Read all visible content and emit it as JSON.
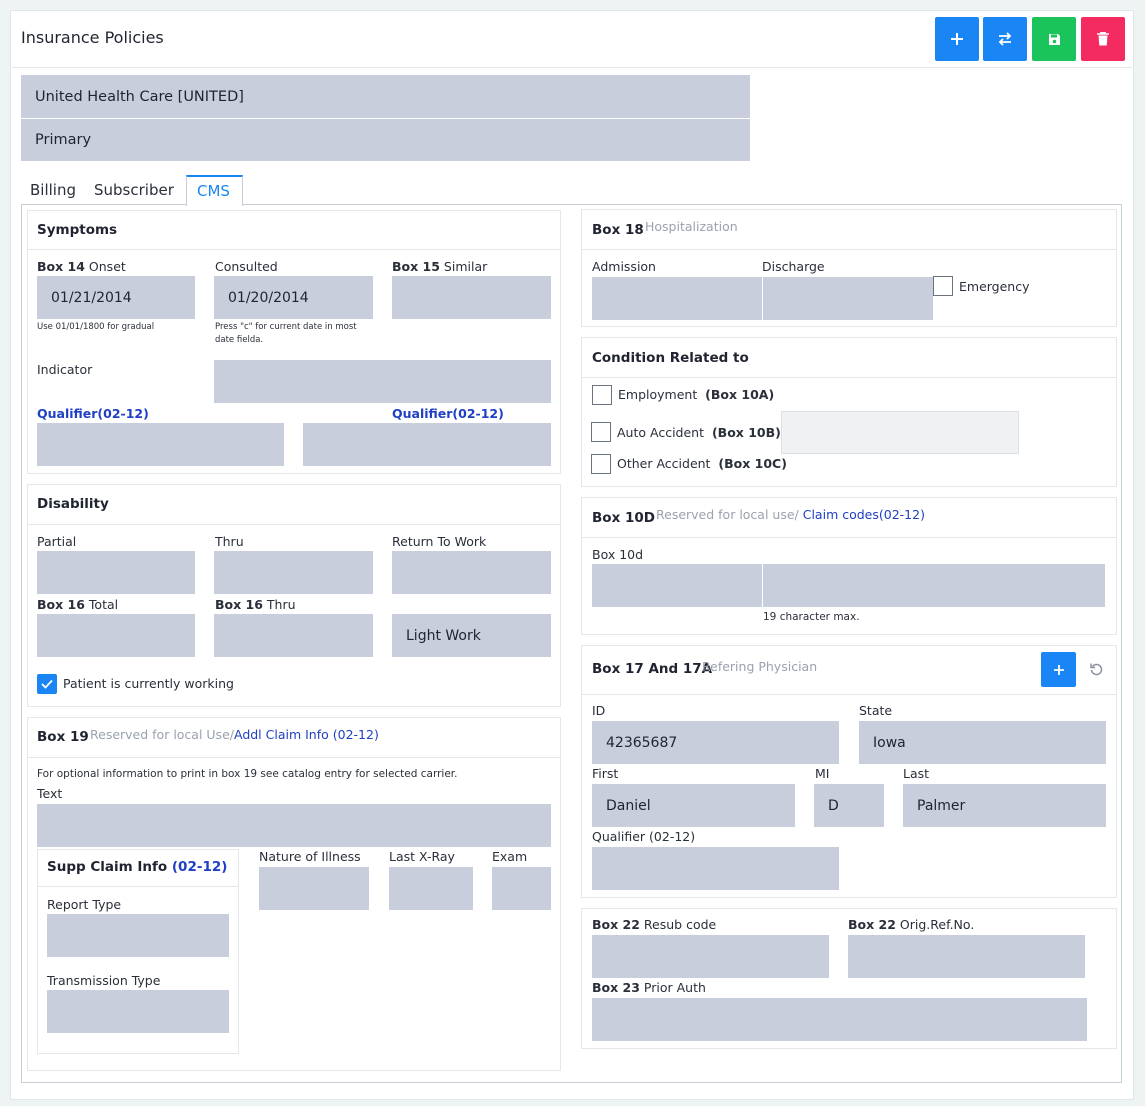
{
  "header": {
    "title": "Insurance Policies",
    "buttons": {
      "add": {
        "icon": "plus-icon",
        "color": "#1a86f5"
      },
      "swap": {
        "icon": "swap-icon",
        "color": "#1a86f5"
      },
      "save": {
        "icon": "floppy-disk-icon",
        "color": "#1bc45a"
      },
      "delete": {
        "icon": "trash-icon",
        "color": "#f32b60"
      }
    }
  },
  "policy": {
    "carrier": "United Health Care [UNITED]",
    "priority": "Primary"
  },
  "tabs": [
    "Billing",
    "Subscriber",
    "CMS"
  ],
  "active_tab": "CMS",
  "symptoms": {
    "title": "Symptoms",
    "box14_prefix": "Box 14",
    "box14_label": "Onset",
    "box14_value": "01/21/2014",
    "box14_hint": "Use 01/01/1800 for gradual",
    "consulted_label": "Consulted",
    "consulted_value": "01/20/2014",
    "consulted_hint": "Press \"c\" for current date in most date fielda.",
    "box15_prefix": "Box 15",
    "box15_label": "Similar",
    "indicator_label": "Indicator",
    "qualifier_label_1": "Qualifier(02-12)",
    "qualifier_label_2": "Qualifier(02-12)"
  },
  "disability": {
    "title": "Disability",
    "partial_label": "Partial",
    "thru_label": "Thru",
    "return_label": "Return To Work",
    "box16_total_prefix": "Box 16",
    "box16_total_label": "Total",
    "box16_thru_prefix": "Box 16",
    "box16_thru_label": "Thru",
    "light_work_value": "Light Work",
    "working_label": "Patient is currently working",
    "working_checked": true
  },
  "box19": {
    "title": "Box 19",
    "muted": "Reserved for local Use/",
    "link": "Addl Claim Info (02-12)",
    "info": "For optional information to print in box 19 see catalog entry for selected carrier.",
    "text_label": "Text",
    "supp_title": "Supp Claim Info",
    "supp_suffix": "(02-12)",
    "report_type_label": "Report Type",
    "transmission_type_label": "Transmission Type",
    "nature_label": "Nature of Illness",
    "xray_label": "Last X-Ray",
    "exam_label": "Exam"
  },
  "box18": {
    "title": "Box 18",
    "muted": "Hospitalization",
    "admission_label": "Admission",
    "discharge_label": "Discharge",
    "emergency_label": "Emergency"
  },
  "condition": {
    "title": "Condition Related to",
    "employment_label": "Employment",
    "employment_box": "(Box 10A)",
    "auto_label": "Auto Accident",
    "auto_box": "(Box 10B)",
    "other_label": "Other Accident",
    "other_box": "(Box 10C)"
  },
  "box10d": {
    "title": "Box 10D",
    "muted": "Reserved for local use/",
    "link": "Claim codes(02-12)",
    "field_label": "Box 10d",
    "hint": "19 character max."
  },
  "box17": {
    "title": "Box 17 And 17A",
    "muted": "Refering Physician",
    "id_label": "ID",
    "id_value": "42365687",
    "state_label": "State",
    "state_value": "Iowa",
    "first_label": "First",
    "first_value": "Daniel",
    "mi_label": "MI",
    "mi_value": "D",
    "last_label": "Last",
    "last_value": "Palmer",
    "qualifier_label": "Qualifier (02-12)"
  },
  "box22": {
    "resub_prefix": "Box 22",
    "resub_label": "Resub code",
    "orig_prefix": "Box 22",
    "orig_label": "Orig.Ref.No.",
    "prior_prefix": "Box 23",
    "prior_label": "Prior Auth"
  }
}
